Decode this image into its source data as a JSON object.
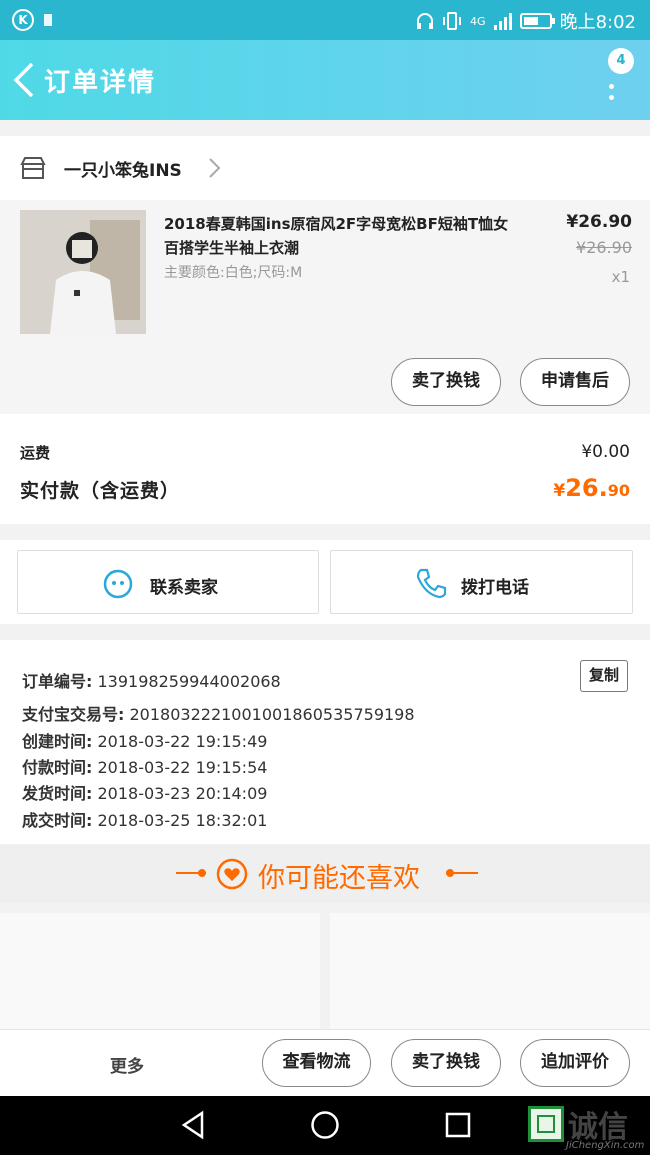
{
  "statusbar": {
    "time": "晚上8:02",
    "network": "4G"
  },
  "header": {
    "title": "订单详情",
    "badge": "4"
  },
  "shop": {
    "name": "一只小笨兔INS"
  },
  "item": {
    "title": "2018春夏韩国ins原宿风2F字母宽松BF短袖T恤女百搭学生半袖上衣潮",
    "sku": "主要颜色:白色;尺码:M",
    "price": "¥26.90",
    "original_price": "¥26.90",
    "quantity": "x1",
    "buttons": {
      "exchange": "卖了换钱",
      "after_sale": "申请售后"
    }
  },
  "fees": {
    "shipping_label": "运费",
    "shipping_value": "¥0.00",
    "paid_label": "实付款（含运费）",
    "paid_symbol": "¥",
    "paid_int": "26.",
    "paid_dec": "90"
  },
  "contact": {
    "seller": "联系卖家",
    "call": "拨打电话"
  },
  "order_info": {
    "copy_label": "复制",
    "rows": [
      {
        "label": "订单编号:",
        "value": "139198259944002068"
      },
      {
        "label": "支付宝交易号:",
        "value": "2018032221001001860535759198"
      },
      {
        "label": "创建时间:",
        "value": "2018-03-22 19:15:49"
      },
      {
        "label": "付款时间:",
        "value": "2018-03-22 19:15:54"
      },
      {
        "label": "发货时间:",
        "value": "2018-03-23 20:14:09"
      },
      {
        "label": "成交时间:",
        "value": "2018-03-25 18:32:01"
      }
    ]
  },
  "recommend": {
    "title": "你可能还喜欢"
  },
  "footer": {
    "more": "更多",
    "logistics": "查看物流",
    "exchange": "卖了换钱",
    "review": "追加评价"
  },
  "watermark": {
    "cn": "诚信",
    "en": "JiChengXin.com"
  },
  "colors": {
    "accent": "#ff6a00",
    "header": "#4fd9e6",
    "statusbar": "#2bb6cf"
  }
}
